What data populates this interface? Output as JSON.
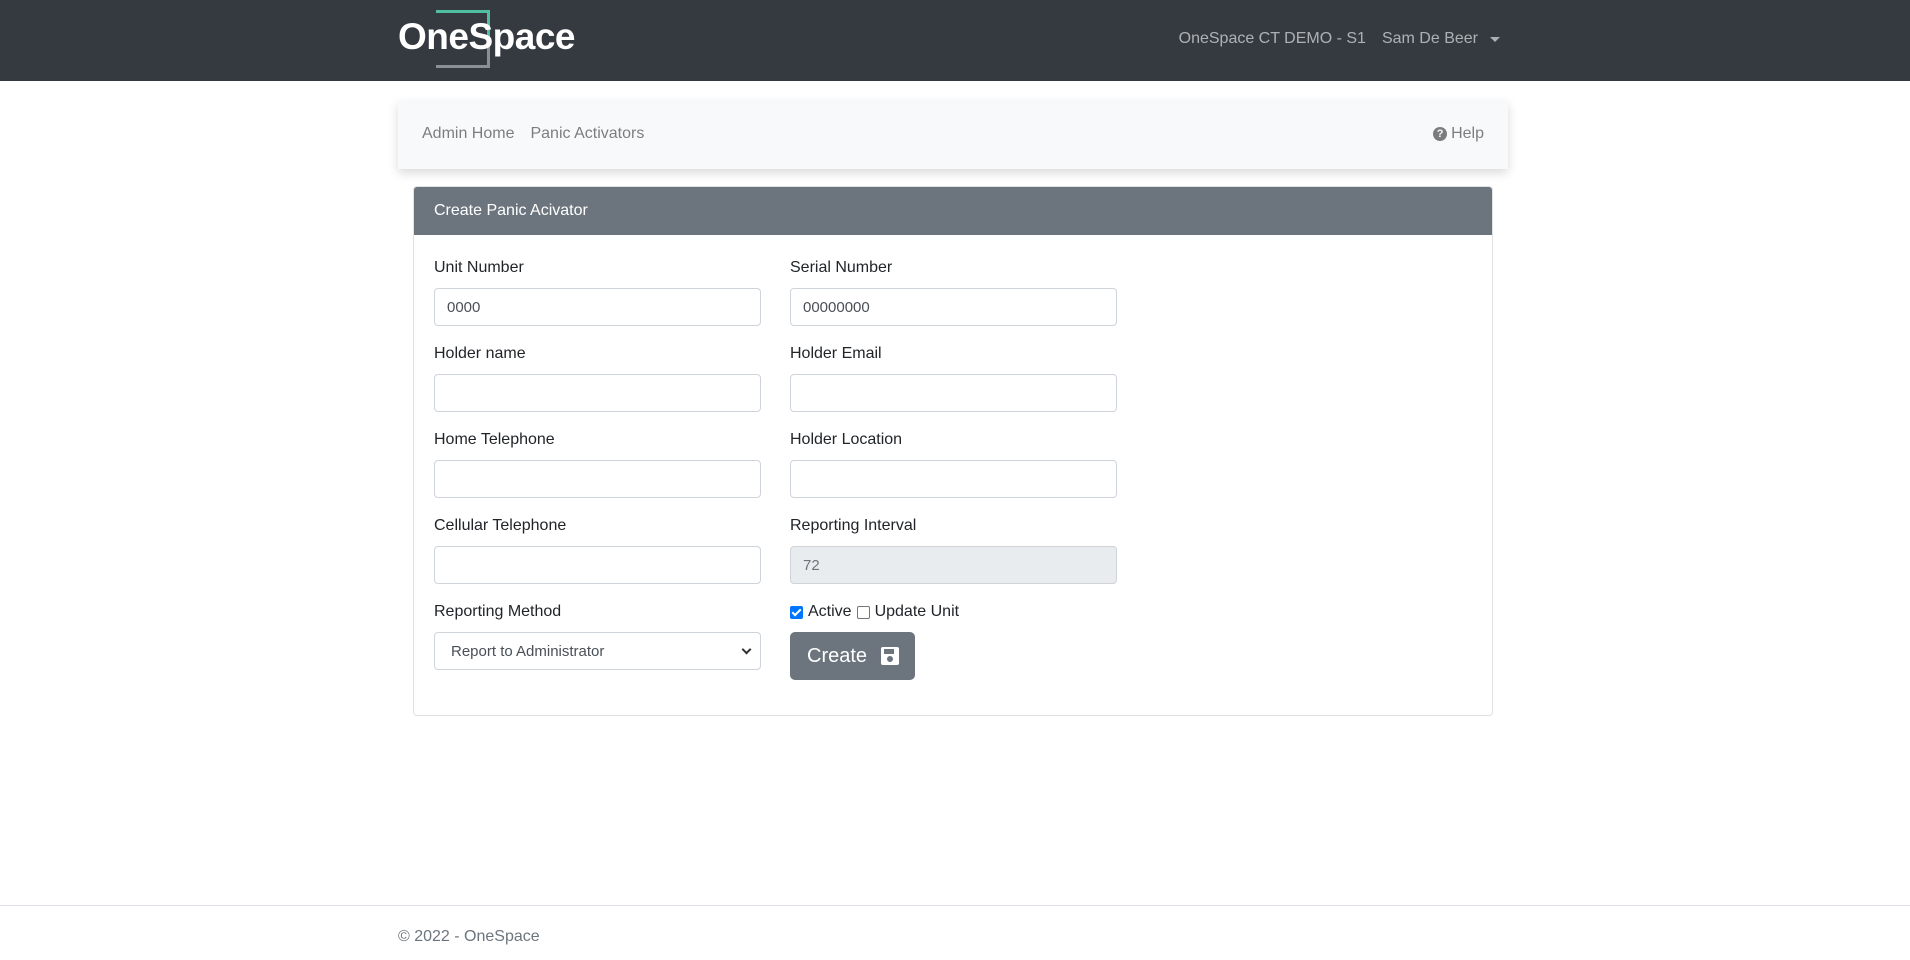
{
  "navbar": {
    "brand": "OneSpace",
    "site": "OneSpace CT DEMO - S1",
    "user": "Sam De Beer"
  },
  "subnav": {
    "links": [
      "Admin Home",
      "Panic Activators"
    ],
    "help": "Help"
  },
  "form": {
    "title": "Create Panic Acivator",
    "unit_number": {
      "label": "Unit Number",
      "value": "0000"
    },
    "serial_number": {
      "label": "Serial Number",
      "value": "00000000"
    },
    "holder_name": {
      "label": "Holder name",
      "value": ""
    },
    "holder_email": {
      "label": "Holder Email",
      "value": ""
    },
    "home_telephone": {
      "label": "Home Telephone",
      "value": ""
    },
    "holder_location": {
      "label": "Holder Location",
      "value": ""
    },
    "cellular_telephone": {
      "label": "Cellular Telephone",
      "value": ""
    },
    "reporting_interval": {
      "label": "Reporting Interval",
      "value": "72"
    },
    "reporting_method": {
      "label": "Reporting Method",
      "value": "Report to Administrator"
    },
    "active": {
      "label": "Active",
      "checked": true
    },
    "update_unit": {
      "label": "Update Unit",
      "checked": false
    },
    "create_label": "Create"
  },
  "footer": {
    "text": "© 2022 - OneSpace"
  }
}
